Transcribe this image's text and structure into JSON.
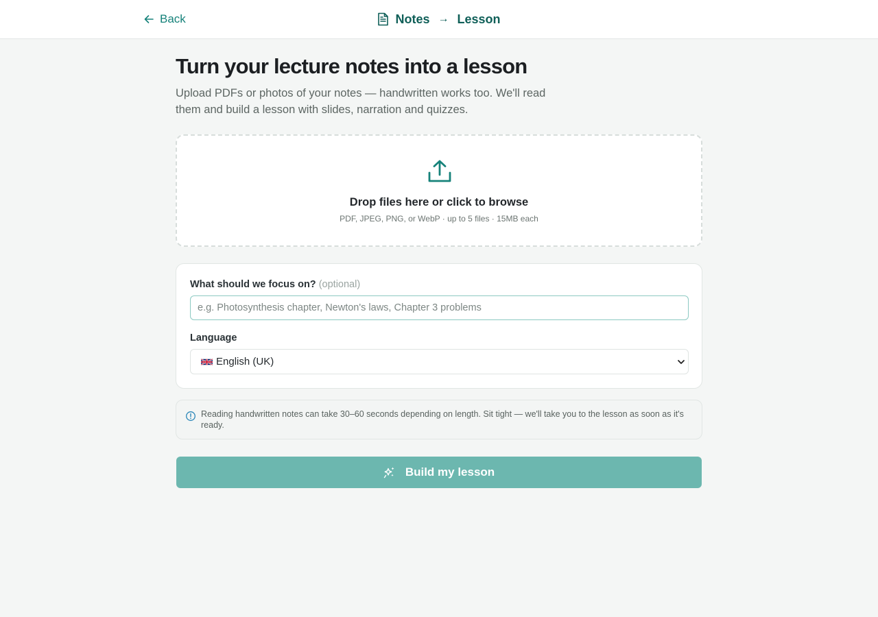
{
  "header": {
    "back_label": "Back",
    "brand_from": "Notes",
    "brand_arrow": "→",
    "brand_to": "Lesson",
    "accent_color": "#16827a"
  },
  "page": {
    "title": "Turn your lecture notes into a lesson",
    "subtitle": "Upload PDFs or photos of your notes — handwritten works too. We'll read them and build a lesson with slides, narration and quizzes."
  },
  "dropzone": {
    "icon": "upload-icon",
    "title": "Drop files here or click to browse",
    "hint": "PDF, JPEG, PNG, or WebP · up to 5 files · 15MB each"
  },
  "form": {
    "focus_label": "What should we focus on?",
    "focus_optional": "(optional)",
    "focus_placeholder": "e.g. Photosynthesis chapter, Newton's laws, Chapter 3 problems",
    "focus_value": "",
    "language_label": "Language",
    "language_value": "English (UK)",
    "language_flag": "uk-flag-icon"
  },
  "notice": {
    "icon": "info-icon",
    "text": "Reading handwritten notes can take 30–60 seconds depending on length. Sit tight — we'll take you to the lesson as soon as it's ready."
  },
  "actions": {
    "build_label": "Build my lesson",
    "build_icon": "sparkles-icon",
    "build_color": "#6cb7af"
  }
}
